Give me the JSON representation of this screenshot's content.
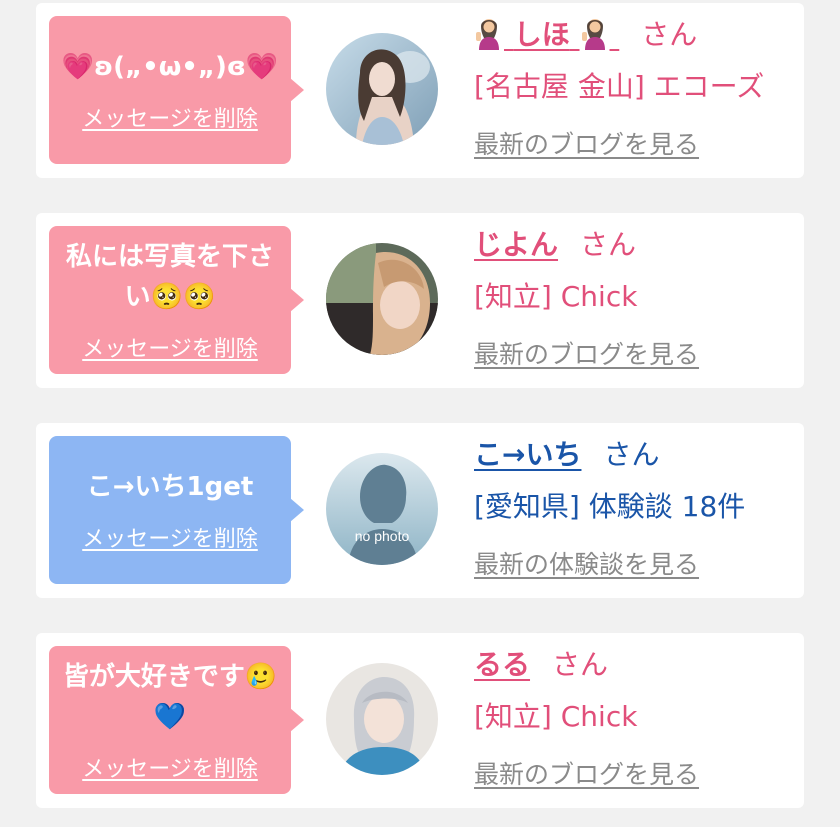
{
  "cards": [
    {
      "message": "💗ʚ(„•ω•„)ɞ💗",
      "delete_label": "メッセージを削除",
      "name": "しほ",
      "honorific": "さん",
      "shop": "[名古屋 金山] エコーズ",
      "blog_link": "最新のブログを見る",
      "theme": "pink"
    },
    {
      "message": "私には写真を下さい🥺🥺",
      "delete_label": "メッセージを削除",
      "name": "じよん",
      "honorific": "さん",
      "shop": "[知立] Chick",
      "blog_link": "最新のブログを見る",
      "theme": "pink"
    },
    {
      "message": "こ→いち1get",
      "delete_label": "メッセージを削除",
      "name": "こ→いち",
      "honorific": "さん",
      "shop": "[愛知県] 体験談 18件",
      "blog_link": "最新の体験談を見る",
      "avatar_text": "no photo",
      "theme": "blue"
    },
    {
      "message": "皆が大好きです🥲💙",
      "delete_label": "メッセージを削除",
      "name": "るる",
      "honorific": "さん",
      "shop": "[知立] Chick",
      "blog_link": "最新のブログを見る",
      "theme": "pink"
    }
  ],
  "colors": {
    "pink_bubble": "#f99aa8",
    "blue_bubble": "#8db6f3",
    "pink_text": "#e14f7a",
    "blue_text": "#1a55a8",
    "link_gray": "#8a8a8a"
  }
}
